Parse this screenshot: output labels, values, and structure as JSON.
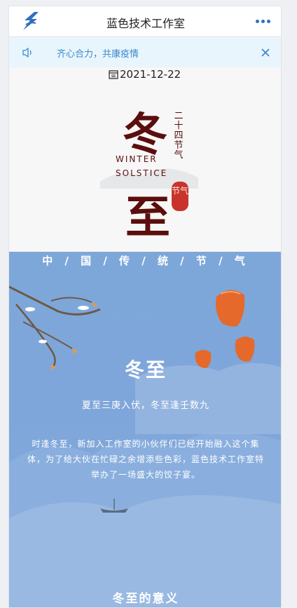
{
  "header": {
    "title": "蓝色技术工作室",
    "logo_icon": "lightning-logo-icon",
    "more_icon": "more-dots-icon"
  },
  "notice": {
    "text": "齐心合力，共康疫情",
    "icon": "speaker-icon",
    "close_icon": "close-icon"
  },
  "date": "2021-12-22",
  "hero": {
    "char_top": "冬",
    "char_bottom": "至",
    "vertical_text": "二十四节气",
    "english_line1": "WINTER",
    "english_line2": "SOLSTICE",
    "seal_text": "节气"
  },
  "content": {
    "festival_heading": "中 / 国 / 传 / 统 / 节 / 气",
    "section_title": "冬至",
    "poem": "夏至三庚入伏，冬至逢壬数九",
    "paragraph": "时逢冬至，新加入工作室的小伙伴们已经开始融入这个集体，为了给大伙在忙碌之余增添些色彩，蓝色技术工作室特举办了一场盛大的饺子宴。",
    "next_section_title": "冬至的意义"
  },
  "colors": {
    "accent": "#2f6fbd",
    "notice_bg": "#e9f5fd",
    "notice_text": "#3a89c9",
    "hero_text": "#5a0f0d",
    "seal": "#c8342b",
    "scene_bg": "#7fa6da"
  }
}
